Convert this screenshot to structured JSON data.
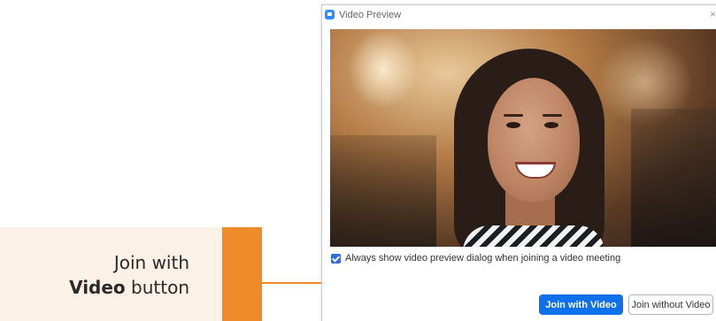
{
  "callout": {
    "line1": "Join with",
    "line2_bold": "Video",
    "line2_rest": " button",
    "accent_color": "#ef8a2b",
    "background_color": "#fcf1e6"
  },
  "dialog": {
    "title": "Video Preview",
    "close_glyph": "×",
    "app_icon": "zoom-camera-icon",
    "checkbox": {
      "checked": true,
      "label": "Always show video preview dialog when joining a video meeting"
    },
    "buttons": {
      "join_with_video": "Join with Video",
      "join_without_video": "Join without Video"
    },
    "colors": {
      "primary_button": "#0e71eb",
      "checkbox": "#2d6dd6"
    }
  }
}
